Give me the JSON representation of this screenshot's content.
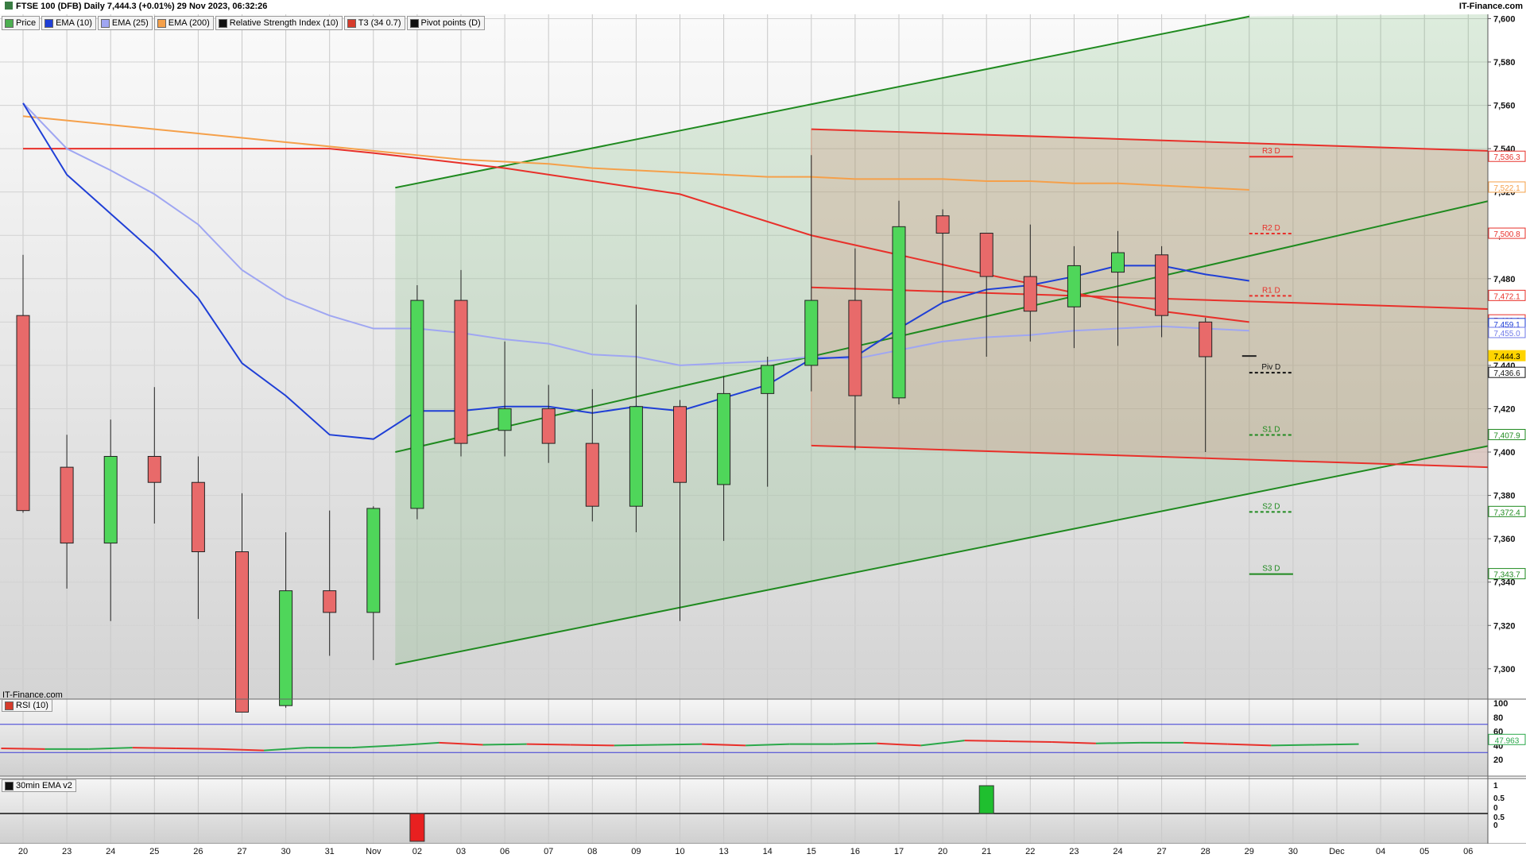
{
  "header": {
    "title": "FTSE 100 (DFB) Daily 7,444.3 (+0.01%) 29 Nov 2023, 06:32:26",
    "brand": "IT-Finance.com"
  },
  "legend": [
    {
      "label": "Price",
      "color": "#4caf50"
    },
    {
      "label": "EMA (10)",
      "color": "#1f3fd6"
    },
    {
      "label": "EMA (25)",
      "color": "#9fa6f2"
    },
    {
      "label": "EMA (200)",
      "color": "#f5a04a"
    },
    {
      "label": "Relative Strength Index (10)",
      "color": "#111111"
    },
    {
      "label": "T3 (34 0.7)",
      "color": "#d63b2b"
    },
    {
      "label": "Pivot points (D)",
      "color": "#111111"
    }
  ],
  "watermark": "IT-Finance.com",
  "colors": {
    "up": "#4fd65a",
    "down": "#e86a6a",
    "ema10": "#1f3fd6",
    "ema25": "#9fa6f2",
    "ema200": "#f5a04a",
    "t3": "#e8302a",
    "channel": "#1f8a1f",
    "resistance": "#e8302a",
    "pivot": "#111111",
    "support": "#1f8a1f"
  },
  "chart_data": [
    {
      "type": "candlestick",
      "title": "FTSE 100 (DFB) Daily",
      "x": [
        "20",
        "23",
        "24",
        "25",
        "26",
        "27",
        "30",
        "31",
        "Nov",
        "02",
        "03",
        "06",
        "07",
        "08",
        "09",
        "10",
        "13",
        "14",
        "15",
        "16",
        "17",
        "20",
        "21",
        "22",
        "23",
        "24",
        "27",
        "28",
        "29",
        "30",
        "Dec",
        "04",
        "05",
        "06"
      ],
      "ylim": [
        7286,
        7602
      ],
      "y_ticks": [
        7300,
        7320,
        7340,
        7360,
        7380,
        7400,
        7420,
        7440,
        7460,
        7480,
        7500,
        7520,
        7540,
        7560,
        7580,
        7600
      ],
      "candles": [
        {
          "o": 7463,
          "h": 7491,
          "l": 7372,
          "c": 7373
        },
        {
          "o": 7393,
          "h": 7408,
          "l": 7337,
          "c": 7358
        },
        {
          "o": 7358,
          "h": 7415,
          "l": 7322,
          "c": 7398
        },
        {
          "o": 7398,
          "h": 7430,
          "l": 7367,
          "c": 7386
        },
        {
          "o": 7386,
          "h": 7398,
          "l": 7323,
          "c": 7354
        },
        {
          "o": 7354,
          "h": 7381,
          "l": 7280,
          "c": 7280
        },
        {
          "o": 7283,
          "h": 7363,
          "l": 7282,
          "c": 7336
        },
        {
          "o": 7336,
          "h": 7373,
          "l": 7306,
          "c": 7326
        },
        {
          "o": 7326,
          "h": 7375,
          "l": 7304,
          "c": 7374
        },
        {
          "o": 7374,
          "h": 7477,
          "l": 7369,
          "c": 7470
        },
        {
          "o": 7470,
          "h": 7484,
          "l": 7398,
          "c": 7404
        },
        {
          "o": 7410,
          "h": 7451,
          "l": 7398,
          "c": 7420
        },
        {
          "o": 7420,
          "h": 7431,
          "l": 7395,
          "c": 7404
        },
        {
          "o": 7404,
          "h": 7429,
          "l": 7368,
          "c": 7375
        },
        {
          "o": 7375,
          "h": 7468,
          "l": 7363,
          "c": 7421
        },
        {
          "o": 7421,
          "h": 7424,
          "l": 7322,
          "c": 7386
        },
        {
          "o": 7385,
          "h": 7435,
          "l": 7359,
          "c": 7427
        },
        {
          "o": 7427,
          "h": 7444,
          "l": 7384,
          "c": 7440
        },
        {
          "o": 7440,
          "h": 7537,
          "l": 7428,
          "c": 7470
        },
        {
          "o": 7470,
          "h": 7494,
          "l": 7401,
          "c": 7426
        },
        {
          "o": 7425,
          "h": 7516,
          "l": 7422,
          "c": 7504
        },
        {
          "o": 7509,
          "h": 7512,
          "l": 7469,
          "c": 7501
        },
        {
          "o": 7501,
          "h": 7500,
          "l": 7444,
          "c": 7481
        },
        {
          "o": 7481,
          "h": 7505,
          "l": 7451,
          "c": 7465
        },
        {
          "o": 7467,
          "h": 7495,
          "l": 7448,
          "c": 7486
        },
        {
          "o": 7483,
          "h": 7502,
          "l": 7449,
          "c": 7492
        },
        {
          "o": 7491,
          "h": 7495,
          "l": 7453,
          "c": 7463
        },
        {
          "o": 7460,
          "h": 7462,
          "l": 7400,
          "c": 7444
        }
      ],
      "last_mark": 7444.3,
      "series": [
        {
          "name": "EMA (10)",
          "values": [
            7561,
            7528,
            7510,
            7492,
            7471,
            7441,
            7426,
            7408,
            7406,
            7419,
            7419,
            7421,
            7421,
            7418,
            7421,
            7419,
            7425,
            7431,
            7443,
            7444,
            7457,
            7469,
            7475,
            7477,
            7481,
            7486,
            7486,
            7482,
            7479
          ]
        },
        {
          "name": "EMA (25)",
          "values": [
            7561,
            7540,
            7530,
            7519,
            7505,
            7484,
            7471,
            7463,
            7457,
            7457,
            7455,
            7452,
            7450,
            7445,
            7444,
            7440,
            7441,
            7442,
            7444,
            7443,
            7447,
            7451,
            7453,
            7454,
            7456,
            7457,
            7458,
            7457,
            7456
          ]
        },
        {
          "name": "EMA (200)",
          "values": [
            7555,
            7553,
            7551,
            7549,
            7547,
            7545,
            7543,
            7541,
            7539,
            7537,
            7535,
            7534,
            7533,
            7531,
            7530,
            7529,
            7528,
            7527,
            7527,
            7526,
            7526,
            7526,
            7525,
            7525,
            7524,
            7524,
            7523,
            7522,
            7521
          ]
        }
      ],
      "t3_line": [
        [
          0,
          7540
        ],
        [
          7,
          7540
        ],
        [
          8,
          7538
        ],
        [
          11,
          7531
        ],
        [
          15,
          7519
        ],
        [
          18,
          7500
        ],
        [
          22,
          7482
        ],
        [
          26,
          7465
        ],
        [
          28,
          7460
        ]
      ],
      "channels": [
        {
          "from": [
            8.5,
            7522
          ],
          "to": [
            28,
            7601
          ]
        },
        {
          "from": [
            8.5,
            7400
          ],
          "to": [
            33.5,
            7516
          ]
        },
        {
          "from": [
            8.5,
            7302
          ],
          "to": [
            33.5,
            7403
          ]
        }
      ],
      "resistance_box": {
        "x0": 18,
        "y_top_start": 7549,
        "y_top_end": 7539,
        "y_bot_start": 7403,
        "y_bot_end": 7393
      },
      "t3_flat": {
        "x0": 18,
        "y0": 7476,
        "y1": 7466
      },
      "pivots": [
        {
          "label": "R3 D",
          "value": 7536.3
        },
        {
          "label": "R2 D",
          "value": 7500.8
        },
        {
          "label": "R1 D",
          "value": 7472.1
        },
        {
          "label": "Piv D",
          "value": 7436.6
        },
        {
          "label": "S1 D",
          "value": 7407.9
        },
        {
          "label": "S2 D",
          "value": 7372.4
        },
        {
          "label": "S3 D",
          "value": 7343.7
        }
      ],
      "price_labels": [
        {
          "text": "7,536.3",
          "value": 7536.3,
          "color": "#e8302a"
        },
        {
          "text": "7,522.1",
          "value": 7522.1,
          "color": "#f5a04a"
        },
        {
          "text": "7,500.8",
          "value": 7500.8,
          "color": "#e8302a"
        },
        {
          "text": "7,472.1",
          "value": 7472.1,
          "color": "#e8302a"
        },
        {
          "text": "7,460.8",
          "value": 7460.8,
          "color": "#e8302a"
        },
        {
          "text": "7,459.1",
          "value": 7459.1,
          "color": "#1f3fd6"
        },
        {
          "text": "7,455.0",
          "value": 7455.0,
          "color": "#6f79e8"
        },
        {
          "text": "7,444.3",
          "value": 7444.3,
          "color": "#ffd400"
        },
        {
          "text": "7,436.6",
          "value": 7436.6,
          "color": "#111111"
        },
        {
          "text": "7,407.9",
          "value": 7407.9,
          "color": "#1f8a1f"
        },
        {
          "text": "7,372.4",
          "value": 7372.4,
          "color": "#1f8a1f"
        },
        {
          "text": "7,343.7",
          "value": 7343.7,
          "color": "#1f8a1f"
        }
      ]
    },
    {
      "type": "line",
      "title": "RSI (10)",
      "ylim": [
        0,
        100
      ],
      "y_ticks": [
        100,
        80,
        60,
        40,
        20
      ],
      "bands": [
        70,
        30
      ],
      "values": [
        36,
        35,
        35,
        37,
        36,
        35,
        33,
        37,
        37,
        40,
        44,
        41,
        42,
        41,
        40,
        41,
        42,
        40,
        42,
        42,
        43,
        40,
        47,
        46,
        45,
        43,
        44,
        44,
        42,
        40,
        41,
        42
      ],
      "last_value": "47.963"
    },
    {
      "type": "bar",
      "title": "30min EMA v2",
      "ylim": [
        -1,
        1
      ],
      "y_ticks": [
        "1",
        "0.5",
        "0",
        "0.5",
        "0"
      ],
      "bars": [
        {
          "index": 9,
          "value": -1
        },
        {
          "index": 22,
          "value": 1
        }
      ]
    }
  ]
}
